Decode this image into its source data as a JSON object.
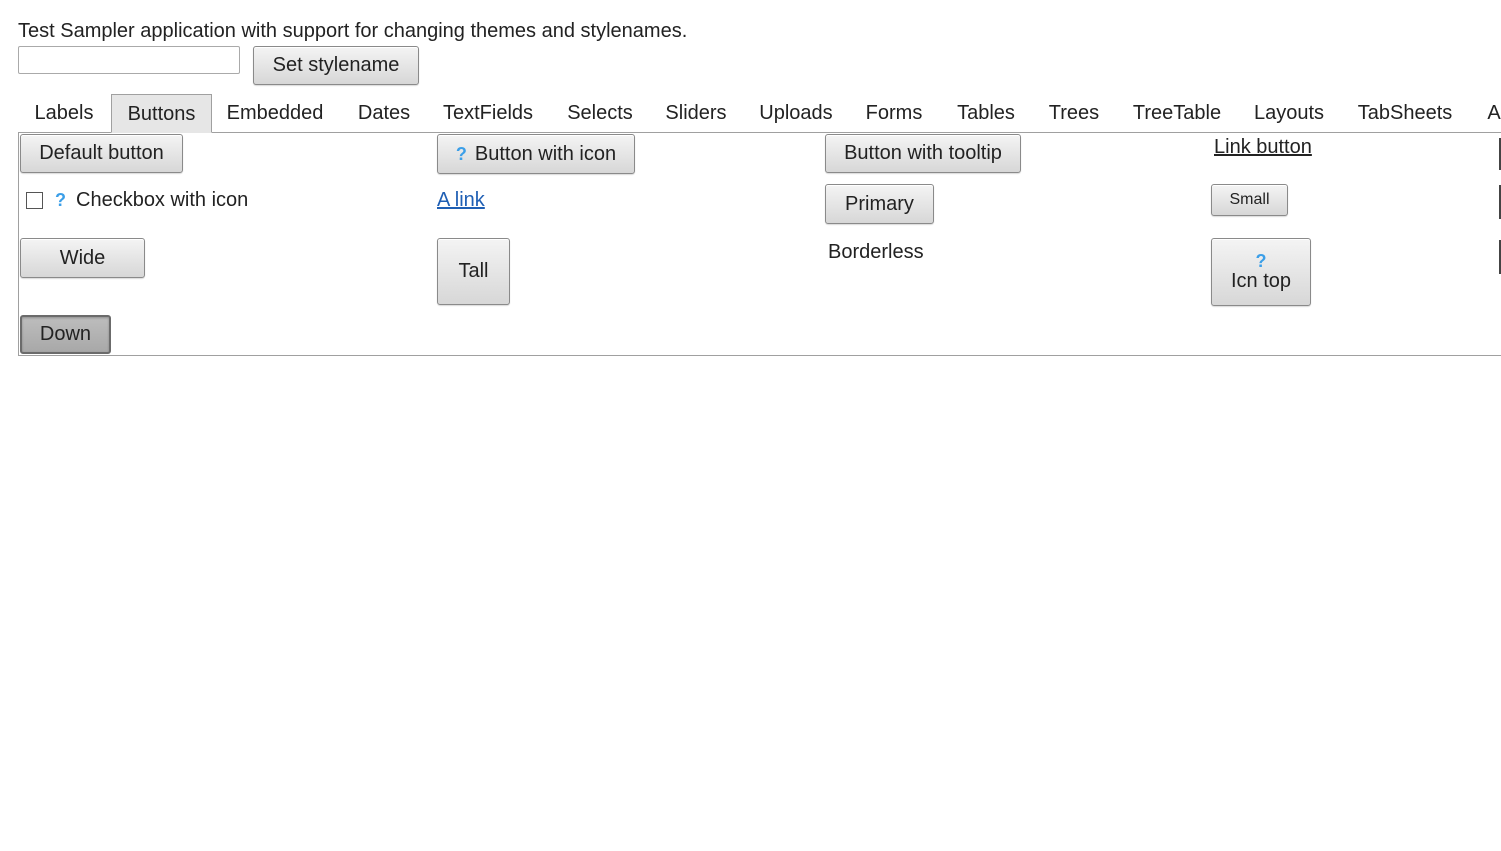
{
  "intro": {
    "text": "Test Sampler application with support for changing themes and stylenames."
  },
  "stylename": {
    "input_value": "",
    "button_label": "Set stylename"
  },
  "tabs": [
    {
      "label": "Labels",
      "active": false
    },
    {
      "label": "Buttons",
      "active": true
    },
    {
      "label": "Embedded",
      "active": false
    },
    {
      "label": "Dates",
      "active": false
    },
    {
      "label": "TextFields",
      "active": false
    },
    {
      "label": "Selects",
      "active": false
    },
    {
      "label": "Sliders",
      "active": false
    },
    {
      "label": "Uploads",
      "active": false
    },
    {
      "label": "Forms",
      "active": false
    },
    {
      "label": "Tables",
      "active": false
    },
    {
      "label": "Trees",
      "active": false
    },
    {
      "label": "TreeTable",
      "active": false
    },
    {
      "label": "Layouts",
      "active": false
    },
    {
      "label": "TabSheets",
      "active": false
    },
    {
      "label": "A",
      "active": false
    }
  ],
  "buttons_panel": {
    "default_button": "Default button",
    "button_with_icon": "Button with icon",
    "button_with_tooltip": "Button with tooltip",
    "link_button": "Link button",
    "checkbox_with_icon": "Checkbox with icon",
    "checkbox_checked": false,
    "a_link": "A link",
    "primary": "Primary",
    "small": "Small",
    "wide": "Wide",
    "tall": "Tall",
    "borderless": "Borderless",
    "icon_top": "Icn top",
    "down": "Down",
    "icon_glyph": "?"
  },
  "colors": {
    "icon_blue": "#3c9fe8",
    "link_blue": "#1f5fb4",
    "active_tab_bg": "#e6e6e6"
  }
}
